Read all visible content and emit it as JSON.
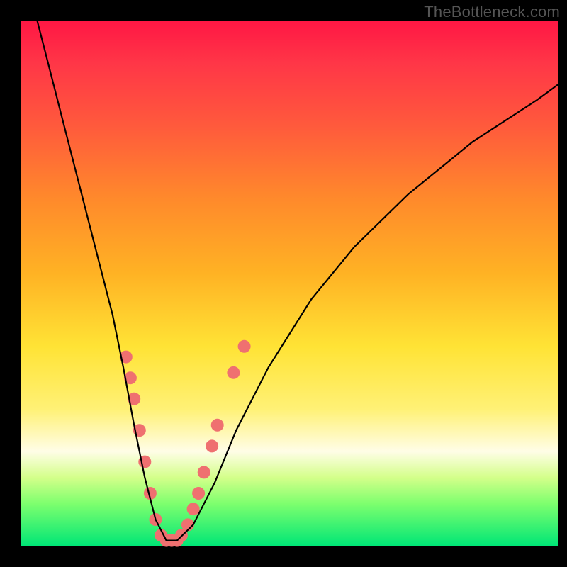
{
  "watermark": "TheBottleneck.com",
  "colors": {
    "frame": "#000000",
    "curve": "#000000",
    "marker": "#ef7070",
    "gradient_stops": [
      "#ff1744",
      "#ff5a3c",
      "#ffb224",
      "#fff176",
      "#d4ff8a",
      "#00e676"
    ]
  },
  "chart_data": {
    "type": "line",
    "title": "",
    "xlabel": "",
    "ylabel": "",
    "xlim": [
      0,
      100
    ],
    "ylim": [
      0,
      100
    ],
    "grid": false,
    "legend": false,
    "series": [
      {
        "name": "bottleneck-curve",
        "x": [
          3,
          5,
          8,
          11,
          14,
          17,
          19,
          21,
          23,
          25,
          27,
          29,
          32,
          36,
          40,
          46,
          54,
          62,
          72,
          84,
          96,
          100
        ],
        "y": [
          100,
          92,
          80,
          68,
          56,
          44,
          34,
          23,
          13,
          5,
          1,
          1,
          4,
          12,
          22,
          34,
          47,
          57,
          67,
          77,
          85,
          88
        ]
      }
    ],
    "markers": [
      {
        "x": 19.5,
        "y": 36
      },
      {
        "x": 20.3,
        "y": 32
      },
      {
        "x": 21.0,
        "y": 28
      },
      {
        "x": 22.0,
        "y": 22
      },
      {
        "x": 23.0,
        "y": 16
      },
      {
        "x": 24.0,
        "y": 10
      },
      {
        "x": 25.0,
        "y": 5
      },
      {
        "x": 26.0,
        "y": 2
      },
      {
        "x": 27.0,
        "y": 1
      },
      {
        "x": 28.0,
        "y": 1
      },
      {
        "x": 29.0,
        "y": 1
      },
      {
        "x": 29.8,
        "y": 2
      },
      {
        "x": 31.0,
        "y": 4
      },
      {
        "x": 32.0,
        "y": 7
      },
      {
        "x": 33.0,
        "y": 10
      },
      {
        "x": 34.0,
        "y": 14
      },
      {
        "x": 35.5,
        "y": 19
      },
      {
        "x": 36.5,
        "y": 23
      },
      {
        "x": 39.5,
        "y": 33
      },
      {
        "x": 41.5,
        "y": 38
      }
    ]
  }
}
